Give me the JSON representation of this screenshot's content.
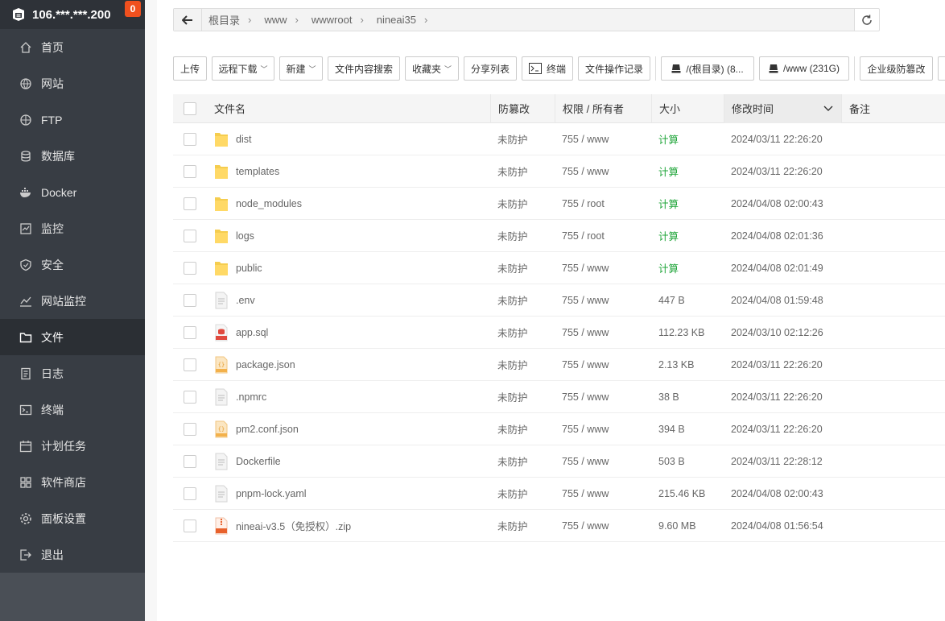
{
  "server": {
    "ip": "106.***.***.200",
    "badge": "0"
  },
  "sidebar": {
    "items": [
      {
        "label": "首页",
        "icon": "home-icon"
      },
      {
        "label": "网站",
        "icon": "globe-icon"
      },
      {
        "label": "FTP",
        "icon": "ftp-icon"
      },
      {
        "label": "数据库",
        "icon": "database-icon"
      },
      {
        "label": "Docker",
        "icon": "docker-icon"
      },
      {
        "label": "监控",
        "icon": "monitor-icon"
      },
      {
        "label": "安全",
        "icon": "shield-icon"
      },
      {
        "label": "网站监控",
        "icon": "chart-icon"
      },
      {
        "label": "文件",
        "icon": "folder-icon"
      },
      {
        "label": "日志",
        "icon": "log-icon"
      },
      {
        "label": "终端",
        "icon": "terminal-icon"
      },
      {
        "label": "计划任务",
        "icon": "calendar-icon"
      },
      {
        "label": "软件商店",
        "icon": "apps-icon"
      },
      {
        "label": "面板设置",
        "icon": "gear-icon"
      },
      {
        "label": "退出",
        "icon": "logout-icon"
      }
    ],
    "active_index": 8
  },
  "path": {
    "crumbs": [
      "根目录",
      "www",
      "wwwroot",
      "nineai35"
    ]
  },
  "toolbar": {
    "upload": "上传",
    "remote_download": "远程下载",
    "new": "新建",
    "content_search": "文件内容搜索",
    "favorites": "收藏夹",
    "share_list": "分享列表",
    "terminal": "终端",
    "op_log": "文件操作记录",
    "disk_root": "/(根目录) (8...",
    "disk_www": "/www (231G)",
    "tamper": "企业级防篡改"
  },
  "table": {
    "headers": {
      "name": "文件名",
      "tamper": "防篡改",
      "perm": "权限 / 所有者",
      "size": "大小",
      "mtime": "修改时间",
      "note": "备注"
    },
    "rows": [
      {
        "type": "folder",
        "name": "dist",
        "tamper": "未防护",
        "perm": "755 / www",
        "size": "计算",
        "mtime": "2024/03/11 22:26:20"
      },
      {
        "type": "folder",
        "name": "templates",
        "tamper": "未防护",
        "perm": "755 / www",
        "size": "计算",
        "mtime": "2024/03/11 22:26:20"
      },
      {
        "type": "folder",
        "name": "node_modules",
        "tamper": "未防护",
        "perm": "755 / root",
        "size": "计算",
        "mtime": "2024/04/08 02:00:43"
      },
      {
        "type": "folder",
        "name": "logs",
        "tamper": "未防护",
        "perm": "755 / root",
        "size": "计算",
        "mtime": "2024/04/08 02:01:36"
      },
      {
        "type": "folder",
        "name": "public",
        "tamper": "未防护",
        "perm": "755 / www",
        "size": "计算",
        "mtime": "2024/04/08 02:01:49"
      },
      {
        "type": "text",
        "name": ".env",
        "tamper": "未防护",
        "perm": "755 / www",
        "size": "447 B",
        "mtime": "2024/04/08 01:59:48"
      },
      {
        "type": "sql",
        "name": "app.sql",
        "tamper": "未防护",
        "perm": "755 / www",
        "size": "112.23 KB",
        "mtime": "2024/03/10 02:12:26"
      },
      {
        "type": "json",
        "name": "package.json",
        "tamper": "未防护",
        "perm": "755 / www",
        "size": "2.13 KB",
        "mtime": "2024/03/11 22:26:20"
      },
      {
        "type": "text",
        "name": ".npmrc",
        "tamper": "未防护",
        "perm": "755 / www",
        "size": "38 B",
        "mtime": "2024/03/11 22:26:20"
      },
      {
        "type": "json",
        "name": "pm2.conf.json",
        "tamper": "未防护",
        "perm": "755 / www",
        "size": "394 B",
        "mtime": "2024/03/11 22:26:20"
      },
      {
        "type": "text",
        "name": "Dockerfile",
        "tamper": "未防护",
        "perm": "755 / www",
        "size": "503 B",
        "mtime": "2024/03/11 22:28:12"
      },
      {
        "type": "text",
        "name": "pnpm-lock.yaml",
        "tamper": "未防护",
        "perm": "755 / www",
        "size": "215.46 KB",
        "mtime": "2024/04/08 02:00:43"
      },
      {
        "type": "zip",
        "name": "nineai-v3.5（免授权）.zip",
        "tamper": "未防护",
        "perm": "755 / www",
        "size": "9.60 MB",
        "mtime": "2024/04/08 01:56:54"
      }
    ]
  },
  "colors": {
    "sidebar_bg": "#383d44",
    "accent_green": "#20a53a",
    "badge": "#f0501e"
  }
}
